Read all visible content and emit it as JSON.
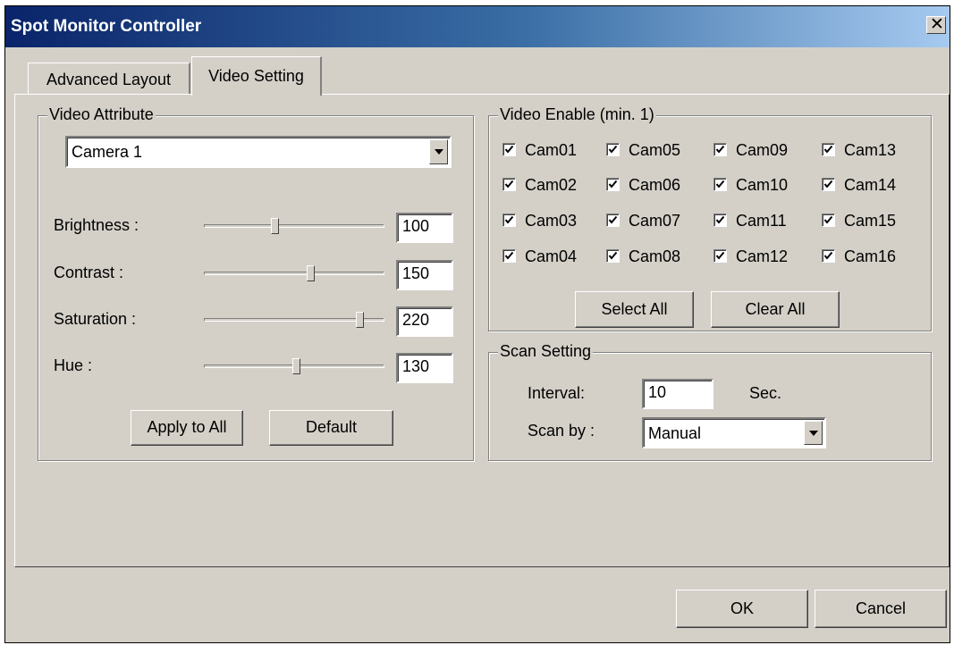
{
  "window": {
    "title": "Spot Monitor Controller"
  },
  "tabs": [
    {
      "label": "Advanced Layout",
      "active": false
    },
    {
      "label": "Video Setting",
      "active": true
    }
  ],
  "video_attribute": {
    "group_title": "Video Attribute",
    "camera_select": "Camera 1",
    "sliders": [
      {
        "label": "Brightness :",
        "value": "100",
        "level": 0.39
      },
      {
        "label": "Contrast :",
        "value": "150",
        "level": 0.59
      },
      {
        "label": "Saturation :",
        "value": "220",
        "level": 0.86
      },
      {
        "label": "Hue :",
        "value": "130",
        "level": 0.51
      }
    ],
    "apply_all_label": "Apply to All",
    "default_label": "Default"
  },
  "video_enable": {
    "group_title": "Video Enable (min. 1)",
    "cameras": [
      {
        "label": "Cam01",
        "checked": true
      },
      {
        "label": "Cam05",
        "checked": true
      },
      {
        "label": "Cam09",
        "checked": true
      },
      {
        "label": "Cam13",
        "checked": true
      },
      {
        "label": "Cam02",
        "checked": true
      },
      {
        "label": "Cam06",
        "checked": true
      },
      {
        "label": "Cam10",
        "checked": true
      },
      {
        "label": "Cam14",
        "checked": true
      },
      {
        "label": "Cam03",
        "checked": true
      },
      {
        "label": "Cam07",
        "checked": true
      },
      {
        "label": "Cam11",
        "checked": true
      },
      {
        "label": "Cam15",
        "checked": true
      },
      {
        "label": "Cam04",
        "checked": true
      },
      {
        "label": "Cam08",
        "checked": true
      },
      {
        "label": "Cam12",
        "checked": true
      },
      {
        "label": "Cam16",
        "checked": true
      }
    ],
    "select_all_label": "Select All",
    "clear_all_label": "Clear All"
  },
  "scan_setting": {
    "group_title": "Scan Setting",
    "interval_label": "Interval:",
    "interval_value": "10",
    "interval_unit": "Sec.",
    "scan_by_label": "Scan by :",
    "scan_by_value": "Manual"
  },
  "footer": {
    "ok_label": "OK",
    "cancel_label": "Cancel"
  },
  "colors": {
    "dialog_face": "#d4d0c8",
    "title_start": "#0a246a",
    "title_end": "#a6caf0"
  }
}
